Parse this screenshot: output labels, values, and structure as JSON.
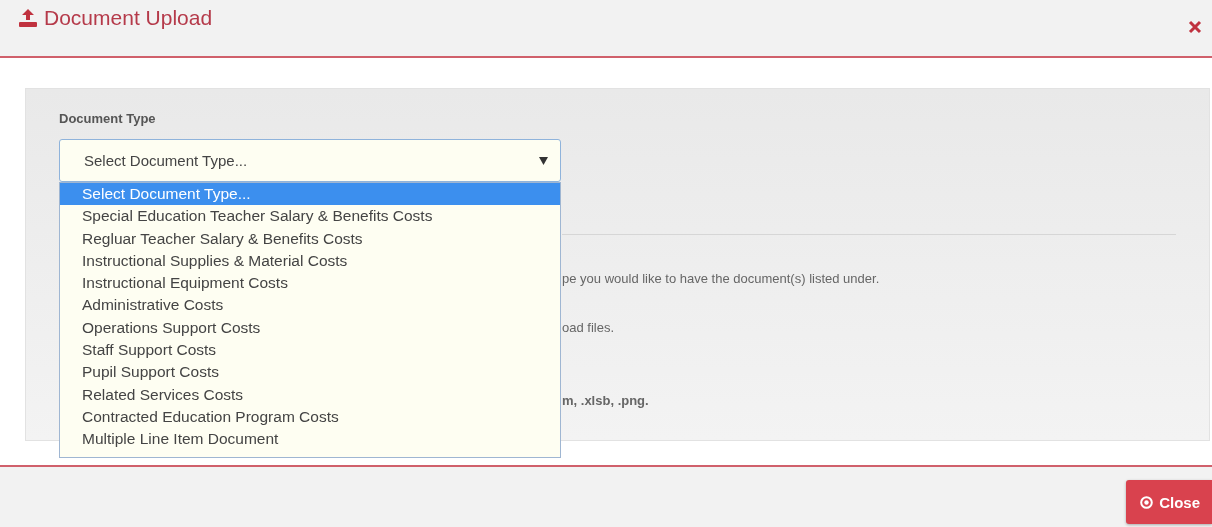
{
  "dialog": {
    "title": "Document Upload"
  },
  "field": {
    "label": "Document Type",
    "value": "Select Document Type...",
    "expanded": true
  },
  "options": [
    {
      "label": "Select Document Type...",
      "selected": true
    },
    {
      "label": "Special Education Teacher Salary & Benefits Costs",
      "selected": false
    },
    {
      "label": "Regluar Teacher Salary & Benefits Costs",
      "selected": false
    },
    {
      "label": "Instructional Supplies & Material Costs",
      "selected": false
    },
    {
      "label": "Instructional Equipment Costs",
      "selected": false
    },
    {
      "label": "Administrative Costs",
      "selected": false
    },
    {
      "label": "Operations Support Costs",
      "selected": false
    },
    {
      "label": "Staff Support Costs",
      "selected": false
    },
    {
      "label": "Pupil Support Costs",
      "selected": false
    },
    {
      "label": "Related Services Costs",
      "selected": false
    },
    {
      "label": "Contracted Education Program Costs",
      "selected": false
    },
    {
      "label": "Multiple Line Item Document",
      "selected": false
    }
  ],
  "instructions": [
    {
      "text": "pe you would like to have the document(s) listed under.",
      "bold": false
    },
    {
      "text": "oad files.",
      "bold": false
    },
    {
      "text": "m, .xlsb, .png.",
      "bold": true
    }
  ],
  "footer": {
    "close_button": "Close"
  }
}
